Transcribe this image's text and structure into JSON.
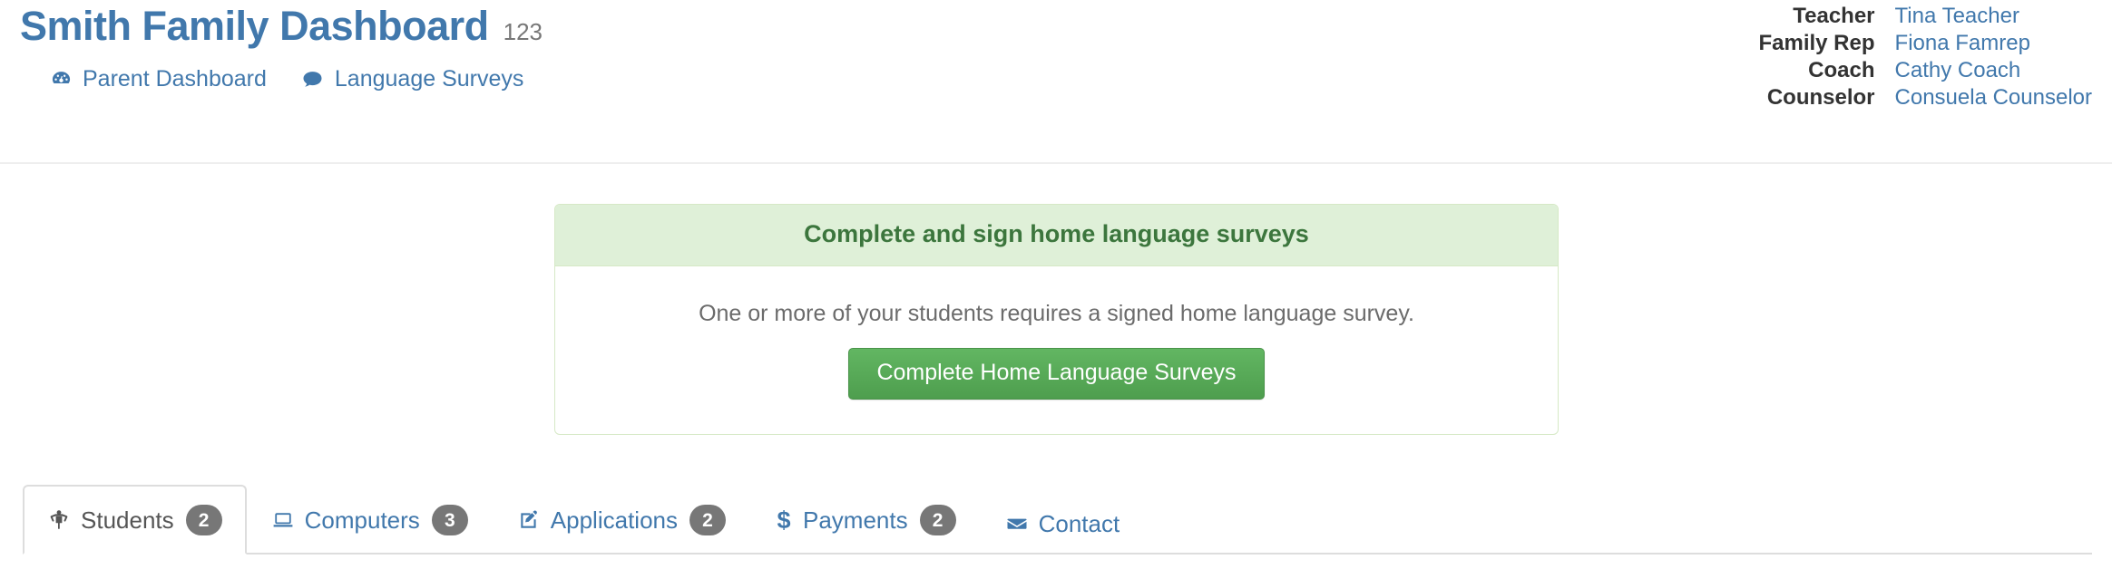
{
  "header": {
    "title": "Smith Family Dashboard",
    "title_suffix": "123",
    "nav_links": [
      {
        "label": "Parent Dashboard",
        "icon": "tachometer-icon"
      },
      {
        "label": "Language Surveys",
        "icon": "comment-icon"
      }
    ],
    "contacts": [
      {
        "role": "Teacher",
        "name": "Tina Teacher"
      },
      {
        "role": "Family Rep",
        "name": "Fiona Famrep"
      },
      {
        "role": "Coach",
        "name": "Cathy Coach"
      },
      {
        "role": "Counselor",
        "name": "Consuela Counselor"
      }
    ]
  },
  "alert_panel": {
    "heading": "Complete and sign home language surveys",
    "body_text": "One or more of your students requires a signed home language survey.",
    "button_label": "Complete Home Language Surveys"
  },
  "tabs": [
    {
      "label": "Students",
      "badge": "2",
      "icon": "child-icon",
      "active": true
    },
    {
      "label": "Computers",
      "badge": "3",
      "icon": "laptop-icon",
      "active": false
    },
    {
      "label": "Applications",
      "badge": "2",
      "icon": "pencil-square-icon",
      "active": false
    },
    {
      "label": "Payments",
      "badge": "2",
      "icon": "dollar-icon",
      "active": false
    },
    {
      "label": "Contact",
      "badge": "",
      "icon": "envelope-icon",
      "active": false
    }
  ],
  "colors": {
    "link_blue": "#4178ac",
    "panel_header_green": "#dff0d8",
    "panel_border_green": "#d6e9c6",
    "panel_title_green": "#3c763d",
    "button_green": "#5cb85c",
    "badge_gray": "#777777",
    "muted_gray": "#777777"
  }
}
